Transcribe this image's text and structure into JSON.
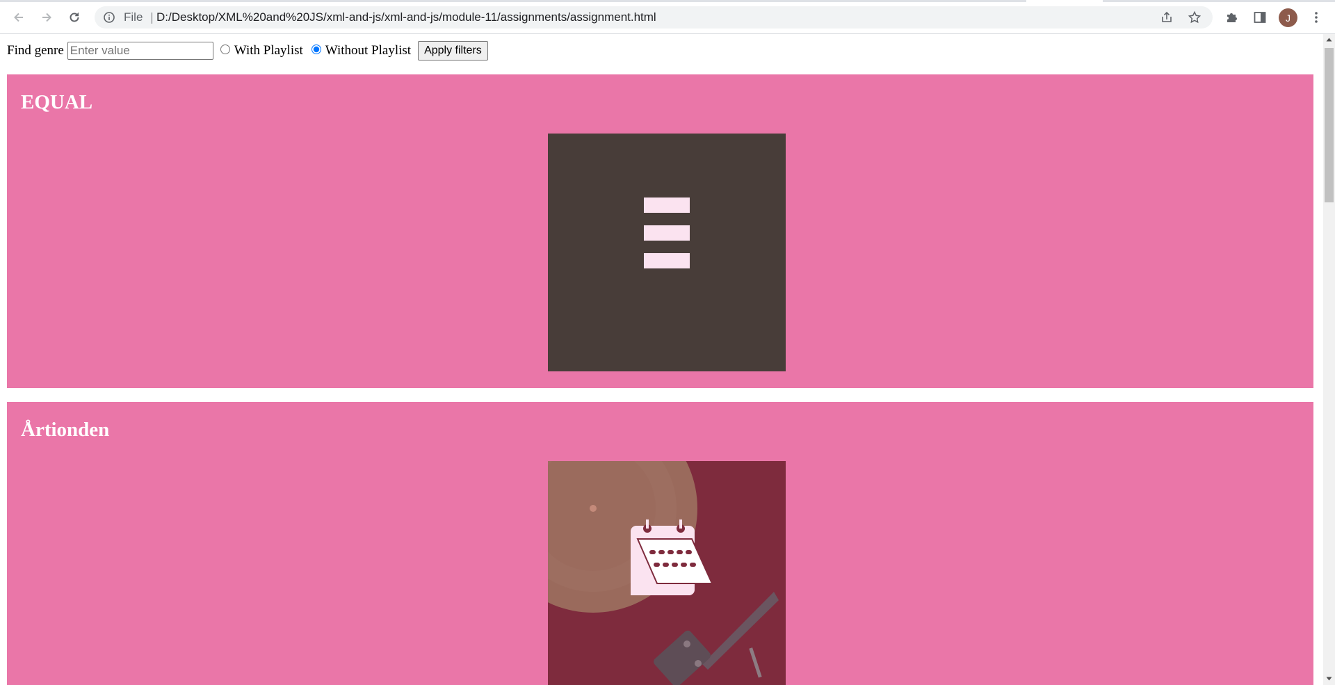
{
  "browser": {
    "scheme": "File",
    "url": "D:/Desktop/XML%20and%20JS/xml-and-js/xml-and-js/module-11/assignments/assignment.html",
    "avatar_letter": "J"
  },
  "filters": {
    "find_label": "Find genre",
    "search_placeholder": "Enter value",
    "search_value": "",
    "with_playlist_label": "With Playlist",
    "without_playlist_label": "Without Playlist",
    "selected": "Without Playlist",
    "apply_label": "Apply filters"
  },
  "genres": [
    {
      "title": "EQUAL",
      "art_icon": "equal-bars-icon"
    },
    {
      "title": "Årtionden",
      "art_icon": "calendar-icon"
    }
  ],
  "colors": {
    "card_bg": "#ea76a8",
    "equal_art_bg": "#483d39",
    "artionden_art_bg": "#7e2b3d",
    "radio_accent": "#1a73e8"
  }
}
